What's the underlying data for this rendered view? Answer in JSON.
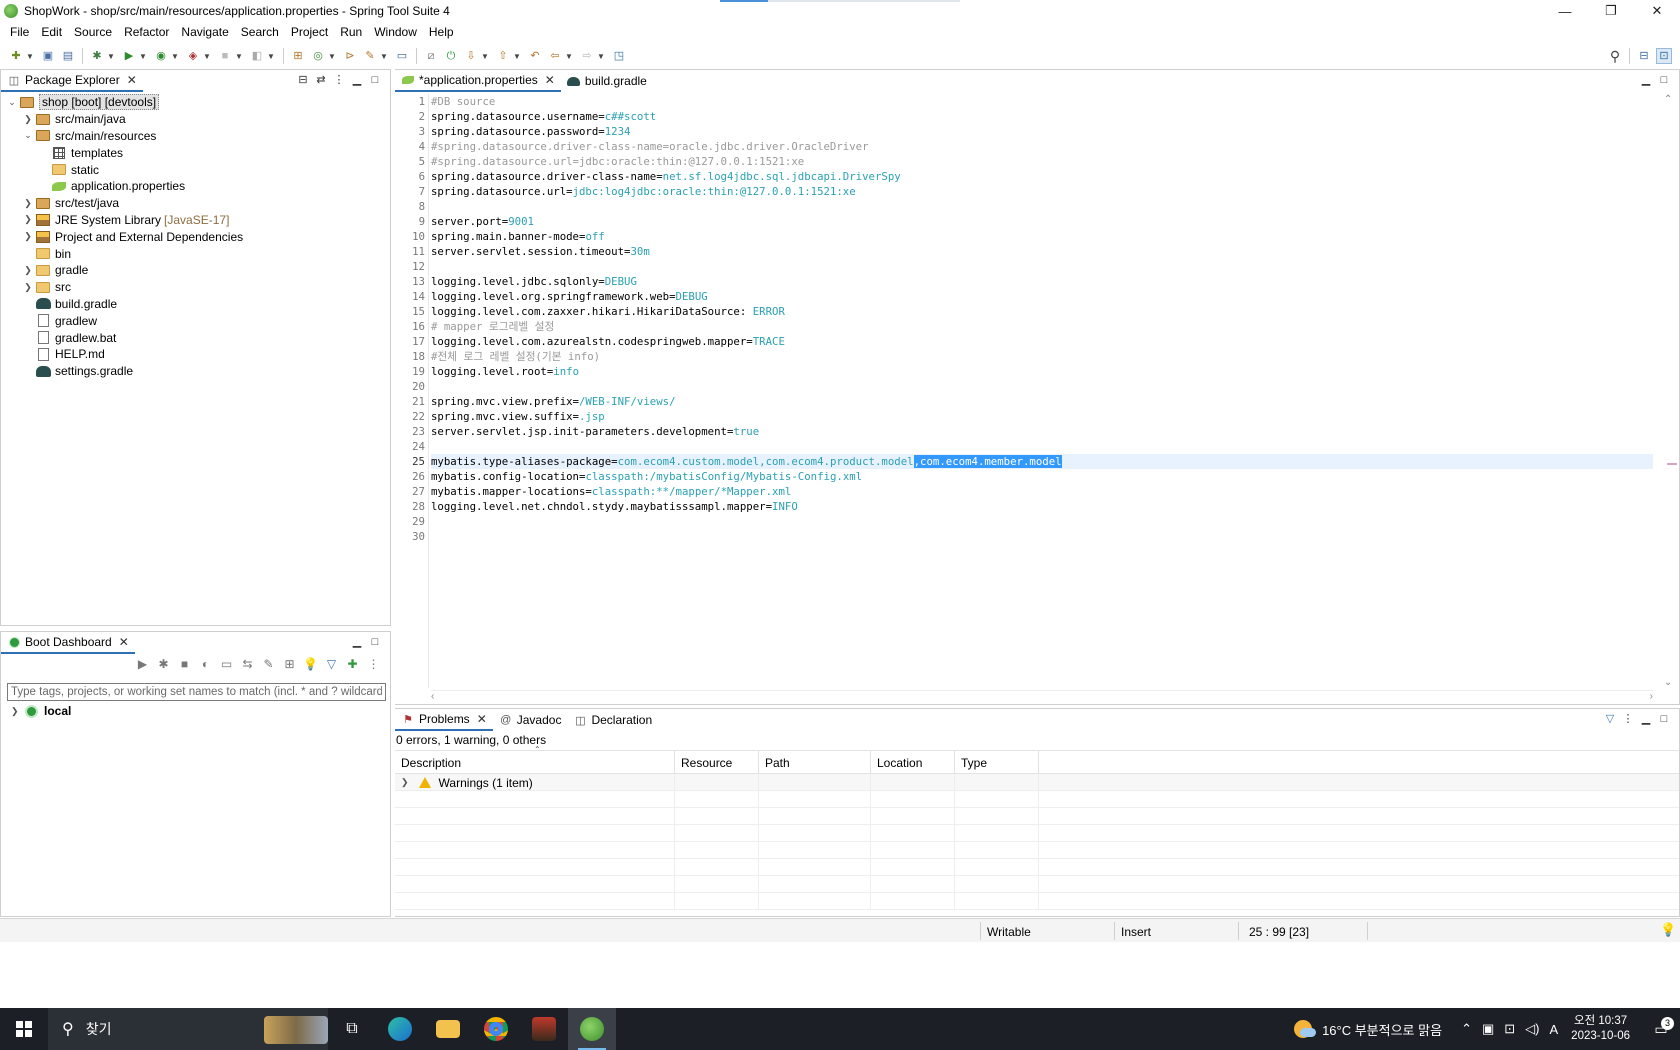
{
  "window": {
    "title": "ShopWork - shop/src/main/resources/application.properties - Spring Tool Suite 4",
    "minimize": "—",
    "maximize": "❐",
    "close": "✕"
  },
  "menu": [
    "File",
    "Edit",
    "Source",
    "Refactor",
    "Navigate",
    "Search",
    "Project",
    "Run",
    "Window",
    "Help"
  ],
  "package_explorer": {
    "tab_label": "Package Explorer",
    "tree": [
      {
        "depth": 0,
        "twisty": "open",
        "icon": "project",
        "label": "shop [boot] [devtools]",
        "selected": true
      },
      {
        "depth": 1,
        "twisty": "closed",
        "icon": "src-folder",
        "label": "src/main/java"
      },
      {
        "depth": 1,
        "twisty": "open",
        "icon": "src-folder",
        "label": "src/main/resources"
      },
      {
        "depth": 2,
        "twisty": "none",
        "icon": "grid",
        "label": "templates"
      },
      {
        "depth": 2,
        "twisty": "none",
        "icon": "folder",
        "label": "static"
      },
      {
        "depth": 2,
        "twisty": "none",
        "icon": "leaf",
        "label": "application.properties"
      },
      {
        "depth": 1,
        "twisty": "closed",
        "icon": "src-folder",
        "label": "src/test/java"
      },
      {
        "depth": 1,
        "twisty": "closed",
        "icon": "library",
        "label": "JRE System Library",
        "decor": "[JavaSE-17]"
      },
      {
        "depth": 1,
        "twisty": "closed",
        "icon": "library",
        "label": "Project and External Dependencies"
      },
      {
        "depth": 1,
        "twisty": "none",
        "icon": "folder",
        "label": "bin"
      },
      {
        "depth": 1,
        "twisty": "closed",
        "icon": "folder",
        "label": "gradle"
      },
      {
        "depth": 1,
        "twisty": "closed",
        "icon": "folder",
        "label": "src"
      },
      {
        "depth": 1,
        "twisty": "none",
        "icon": "elephant",
        "label": "build.gradle"
      },
      {
        "depth": 1,
        "twisty": "none",
        "icon": "file",
        "label": "gradlew"
      },
      {
        "depth": 1,
        "twisty": "none",
        "icon": "file",
        "label": "gradlew.bat"
      },
      {
        "depth": 1,
        "twisty": "none",
        "icon": "file",
        "label": "HELP.md"
      },
      {
        "depth": 1,
        "twisty": "none",
        "icon": "elephant",
        "label": "settings.gradle"
      }
    ]
  },
  "boot_dashboard": {
    "tab_label": "Boot Dashboard",
    "filter_placeholder": "Type tags, projects, or working set names to match (incl. * and ? wildcards)",
    "local_label": "local"
  },
  "editor": {
    "tabs": [
      {
        "label": "*application.properties",
        "active": true
      },
      {
        "label": "build.gradle",
        "active": false
      }
    ],
    "current_line": 25,
    "lines": [
      [
        [
          "c",
          "#DB source"
        ]
      ],
      [
        [
          "k",
          "spring.datasource.username="
        ],
        [
          "v",
          "c##scott"
        ]
      ],
      [
        [
          "k",
          "spring.datasource.password="
        ],
        [
          "v",
          "1234"
        ]
      ],
      [
        [
          "c",
          "#spring.datasource.driver-class-name=oracle.jdbc.driver.OracleDriver"
        ]
      ],
      [
        [
          "c",
          "#spring.datasource.url=jdbc:oracle:thin:@127.0.0.1:1521:xe"
        ]
      ],
      [
        [
          "k",
          "spring.datasource.driver-class-name="
        ],
        [
          "v",
          "net.sf.log4jdbc.sql.jdbcapi.DriverSpy"
        ]
      ],
      [
        [
          "k",
          "spring.datasource.url="
        ],
        [
          "v",
          "jdbc:log4jdbc:oracle:thin:@127.0.0.1:1521:xe"
        ]
      ],
      [],
      [
        [
          "k",
          "server.port="
        ],
        [
          "v",
          "9001"
        ]
      ],
      [
        [
          "k",
          "spring.main.banner-mode="
        ],
        [
          "v",
          "off"
        ]
      ],
      [
        [
          "k",
          "server.servlet.session.timeout="
        ],
        [
          "v",
          "30m"
        ]
      ],
      [],
      [
        [
          "k",
          "logging.level.jdbc.sqlonly="
        ],
        [
          "v",
          "DEBUG"
        ]
      ],
      [
        [
          "k",
          "logging.level.org.springframework.web="
        ],
        [
          "v",
          "DEBUG"
        ]
      ],
      [
        [
          "k",
          "logging.level.com.zaxxer.hikari.HikariDataSource: "
        ],
        [
          "v",
          "ERROR"
        ]
      ],
      [
        [
          "c",
          "# mapper 로그레벨 설정"
        ]
      ],
      [
        [
          "k",
          "logging.level.com.azurealstn.codespringweb.mapper="
        ],
        [
          "v",
          "TRACE"
        ]
      ],
      [
        [
          "c",
          "#전체 로그 레벨 설정(기본 info)"
        ]
      ],
      [
        [
          "k",
          "logging.level.root="
        ],
        [
          "v",
          "info"
        ]
      ],
      [],
      [
        [
          "k",
          "spring.mvc.view.prefix="
        ],
        [
          "v",
          "/WEB-INF/views/"
        ]
      ],
      [
        [
          "k",
          "spring.mvc.view.suffix="
        ],
        [
          "v",
          ".jsp"
        ]
      ],
      [
        [
          "k",
          "server.servlet.jsp.init-parameters.development="
        ],
        [
          "v",
          "true"
        ]
      ],
      [],
      [
        [
          "k",
          "mybatis.type-aliases-package="
        ],
        [
          "v",
          "com.ecom4.custom.model,com.ecom4.product.model"
        ],
        [
          "sel",
          ",com.ecom4.member.model"
        ]
      ],
      [
        [
          "k",
          "mybatis.config-location="
        ],
        [
          "v",
          "classpath:/mybatisConfig/Mybatis-Config.xml"
        ]
      ],
      [
        [
          "k",
          "mybatis.mapper-locations="
        ],
        [
          "v",
          "classpath:**/mapper/*Mapper.xml"
        ]
      ],
      [
        [
          "k",
          "logging.level.net.chndol.stydy.maybatisssampl.mapper="
        ],
        [
          "v",
          "INFO"
        ]
      ],
      [],
      []
    ]
  },
  "problems": {
    "tabs": [
      {
        "label": "Problems",
        "active": true
      },
      {
        "label": "Javadoc",
        "active": false
      },
      {
        "label": "Declaration",
        "active": false
      }
    ],
    "summary": "0 errors, 1 warning, 0 others",
    "columns": [
      "Description",
      "Resource",
      "Path",
      "Location",
      "Type"
    ],
    "rows": [
      {
        "description": "Warnings (1 item)"
      }
    ]
  },
  "statusbar": {
    "writable": "Writable",
    "mode": "Insert",
    "position": "25 : 99 [23]"
  },
  "taskbar": {
    "search_label": "찾기",
    "weather": "16°C 부분적으로 맑음",
    "time": "오전 10:37",
    "date": "2023-10-06",
    "notifications": "3",
    "ime": "A"
  },
  "colors": {
    "value": "#2aa1b3",
    "comment": "#9a9a9a",
    "selection": "#3399ff",
    "current_line": "#e8f2fe",
    "taskbar": "#1c1f26"
  }
}
